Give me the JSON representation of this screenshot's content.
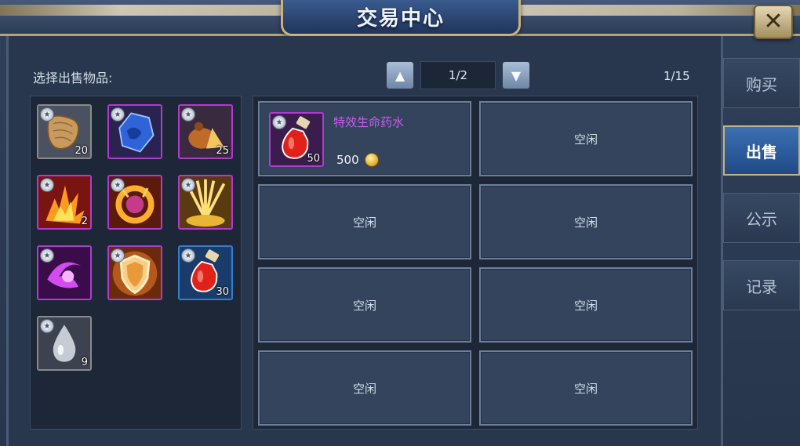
{
  "header": {
    "title": "交易中心",
    "close_glyph": "✕"
  },
  "sell_panel": {
    "label": "选择出售物品:"
  },
  "pager": {
    "up_glyph": "▲",
    "down_glyph": "▼",
    "page": "1/2",
    "slot_count": "1/15"
  },
  "inventory": [
    {
      "name": "scroll-item",
      "rarity": "gray",
      "qty": "20"
    },
    {
      "name": "blue-gem-item",
      "rarity": "purple",
      "qty": ""
    },
    {
      "name": "pouch-item",
      "rarity": "purple",
      "qty": "25"
    },
    {
      "name": "flame-burst-item",
      "rarity": "purple",
      "qty": "2"
    },
    {
      "name": "fire-ring-item",
      "rarity": "purple",
      "qty": ""
    },
    {
      "name": "golden-rays-item",
      "rarity": "purple",
      "qty": ""
    },
    {
      "name": "purple-vortex-item",
      "rarity": "purple",
      "qty": ""
    },
    {
      "name": "shield-item",
      "rarity": "purple",
      "qty": ""
    },
    {
      "name": "red-potion-item",
      "rarity": "blue",
      "qty": "30"
    },
    {
      "name": "water-drop-item",
      "rarity": "gray",
      "qty": "9"
    }
  ],
  "market": {
    "listed": {
      "name": "特效生命药水",
      "qty": "50",
      "price": "500"
    },
    "empty_label": "空闲"
  },
  "tabs": [
    {
      "label": "购买",
      "active": false
    },
    {
      "label": "出售",
      "active": true
    },
    {
      "label": "公示",
      "active": false
    },
    {
      "label": "记录",
      "active": false
    }
  ],
  "colors": {
    "accent_gold": "#c8b27a",
    "name_purple": "#c85cf0",
    "rarity_purple": "#b13ad0",
    "rarity_blue": "#2f7fd0"
  }
}
